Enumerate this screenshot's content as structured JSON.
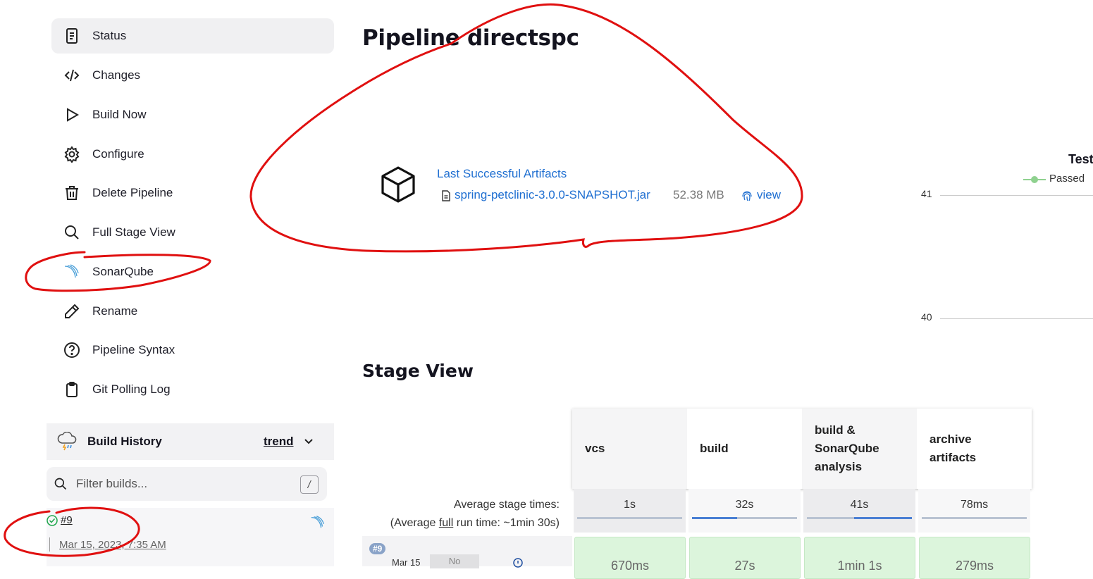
{
  "sidebar": {
    "items": [
      {
        "label": "Status",
        "icon": "document-icon",
        "active": true
      },
      {
        "label": "Changes",
        "icon": "code-icon"
      },
      {
        "label": "Build Now",
        "icon": "play-icon"
      },
      {
        "label": "Configure",
        "icon": "gear-icon"
      },
      {
        "label": "Delete Pipeline",
        "icon": "trash-icon"
      },
      {
        "label": "Full Stage View",
        "icon": "search-icon"
      },
      {
        "label": "SonarQube",
        "icon": "sonarqube-icon"
      },
      {
        "label": "Rename",
        "icon": "pencil-icon"
      },
      {
        "label": "Pipeline Syntax",
        "icon": "help-icon"
      },
      {
        "label": "Git Polling Log",
        "icon": "clipboard-icon"
      }
    ]
  },
  "build_history": {
    "title": "Build History",
    "trend_label": "trend",
    "filter_placeholder": "Filter builds...",
    "filter_shortcut": "/",
    "builds": [
      {
        "number": "#9",
        "date": "Mar 15, 2023, 7:35 AM",
        "status": "success"
      }
    ]
  },
  "main": {
    "title": "Pipeline directspc",
    "artifacts": {
      "heading": "Last Successful Artifacts",
      "file_name": "spring-petclinic-3.0.0-SNAPSHOT.jar",
      "file_size": "52.38 MB",
      "view_label": "view"
    },
    "test_chart": {
      "title": "Test",
      "legend_label": "Passed"
    },
    "stage_view": {
      "title": "Stage View",
      "avg_stage_times_label": "Average stage times:",
      "avg_run_prefix": "(Average ",
      "avg_run_full": "full",
      "avg_run_suffix": " run time: ~1min 30s)",
      "stages": [
        {
          "name": "vcs",
          "avg": "1s",
          "run": "670ms",
          "bar_fraction": 0.0
        },
        {
          "name": "build",
          "avg": "32s",
          "run": "27s",
          "bar_fraction": 0.43
        },
        {
          "name": "build & SonarQube analysis",
          "avg": "41s",
          "run": "1min 1s",
          "bar_fraction": 0.55
        },
        {
          "name": "archive artifacts",
          "avg": "78ms",
          "run": "279ms",
          "bar_fraction": 0.0
        }
      ],
      "run": {
        "badge": "#9",
        "date": "Mar 15",
        "changes": "No"
      }
    }
  },
  "chart_data": {
    "type": "line",
    "title": "Test",
    "series": [
      {
        "name": "Passed",
        "color": "#8fd18f",
        "values": []
      }
    ],
    "y_ticks": [
      41,
      40
    ],
    "grid": true,
    "legend": "top"
  },
  "colors": {
    "link": "#1f6fd1",
    "success": "#1ea64b",
    "stage_success": "#dcf5dc",
    "annotation": "#e01010"
  }
}
